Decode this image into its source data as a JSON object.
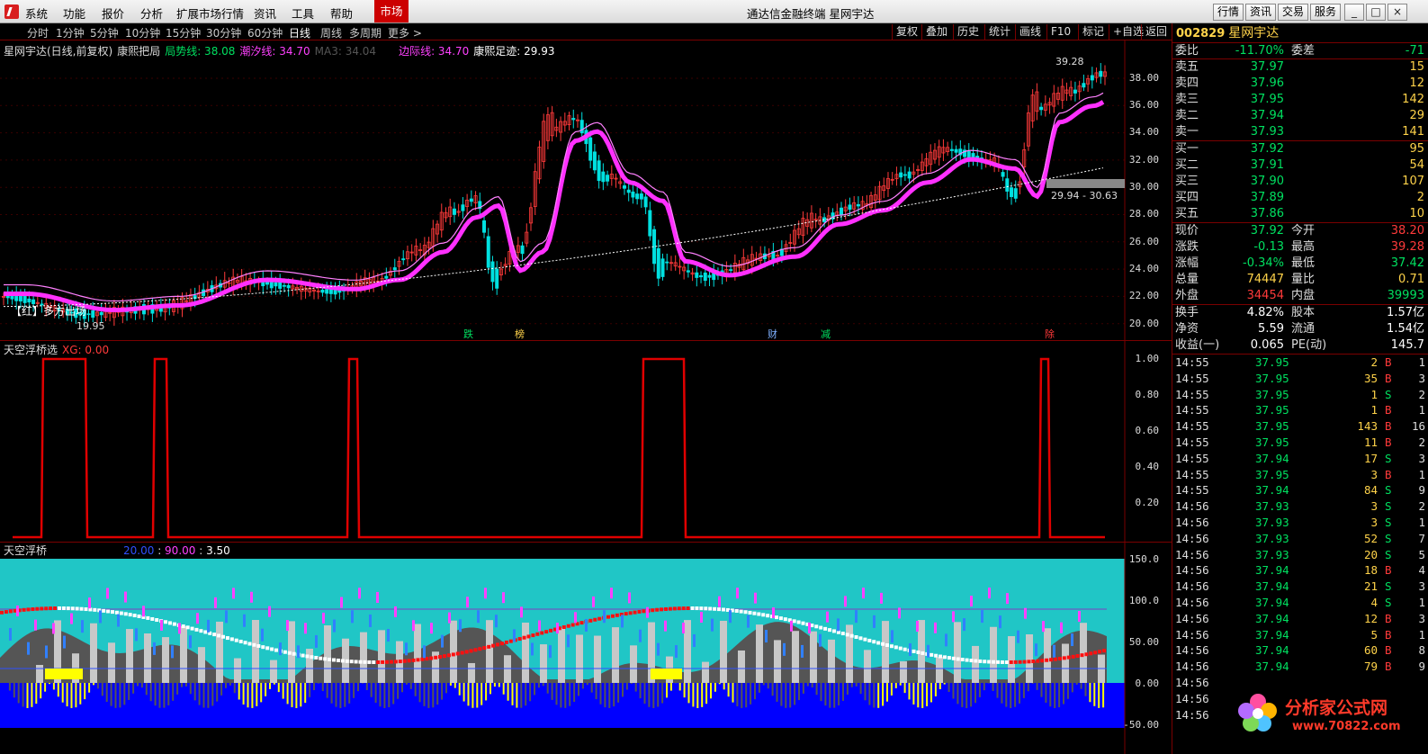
{
  "menu": [
    "系统",
    "功能",
    "报价",
    "分析",
    "扩展市场行情",
    "资讯",
    "工具",
    "帮助"
  ],
  "market_tab": "市场",
  "window_title": "通达信金融终端  星网宇达",
  "top_buttons": [
    "行情",
    "资讯",
    "交易",
    "服务"
  ],
  "window_controls": [
    "_",
    "□",
    "×"
  ],
  "periods": [
    "分时",
    "1分钟",
    "5分钟",
    "10分钟",
    "15分钟",
    "30分钟",
    "60分钟",
    "日线",
    "周线",
    "多周期",
    "更多 >"
  ],
  "active_period": "日线",
  "right_tools": [
    "复权",
    "叠加",
    "历史",
    "统计",
    "画线",
    "F10",
    "标记",
    "+自选",
    "返回"
  ],
  "main_chart": {
    "title": "星网宇达(日线,前复权)",
    "indicator": "康熙把局",
    "trend_label": "局势线: 38.08",
    "trend_color": "#00e060",
    "tide_label": "潮汐线: 34.70",
    "tide_color": "#ff40ff",
    "ma_label": "MA3: 34.04",
    "ma_color": "#555555",
    "edge_label": "边际线: 34.70",
    "edge_color": "#ff40ff",
    "trace_label": "康熙足迹: 29.93",
    "trace_color": "#ffffff",
    "high_marker": "39.28",
    "low_marker": "19.95",
    "range_marker": "29.94 - 30.63",
    "tag_label": "【红】多方出场",
    "event_tags": [
      "跌",
      "榜",
      "财",
      "减",
      "除"
    ],
    "y_ticks": [
      "38.00",
      "36.00",
      "34.00",
      "32.00",
      "30.00",
      "28.00",
      "26.00",
      "24.00",
      "22.00",
      "20.00"
    ]
  },
  "sub1": {
    "title": "天空浮桥选",
    "xg_label": "XG: 0.00",
    "y_ticks": [
      "1.00",
      "0.80",
      "0.60",
      "0.40",
      "0.20"
    ]
  },
  "sub2": {
    "title": "天空浮桥",
    "v1": "20.00",
    "v2": "90.00",
    "v3": "3.50",
    "y_ticks": [
      "150.0",
      "100.0",
      "50.00",
      "0.00",
      "-50.00"
    ]
  },
  "quote": {
    "code": "002829",
    "name": "星网宇达",
    "weibi_label": "委比",
    "weibi": "-11.70%",
    "weicha_label": "委差",
    "weicha": "-71",
    "asks": [
      {
        "label": "卖五",
        "price": "37.97",
        "vol": "15"
      },
      {
        "label": "卖四",
        "price": "37.96",
        "vol": "12"
      },
      {
        "label": "卖三",
        "price": "37.95",
        "vol": "142"
      },
      {
        "label": "卖二",
        "price": "37.94",
        "vol": "29"
      },
      {
        "label": "卖一",
        "price": "37.93",
        "vol": "141"
      }
    ],
    "bids": [
      {
        "label": "买一",
        "price": "37.92",
        "vol": "95"
      },
      {
        "label": "买二",
        "price": "37.91",
        "vol": "54"
      },
      {
        "label": "买三",
        "price": "37.90",
        "vol": "107"
      },
      {
        "label": "买四",
        "price": "37.89",
        "vol": "2"
      },
      {
        "label": "买五",
        "price": "37.86",
        "vol": "10"
      }
    ],
    "stats": [
      {
        "k1": "现价",
        "v1": "37.92",
        "c1": "green",
        "k2": "今开",
        "v2": "38.20",
        "c2": "red"
      },
      {
        "k1": "涨跌",
        "v1": "-0.13",
        "c1": "green",
        "k2": "最高",
        "v2": "39.28",
        "c2": "red"
      },
      {
        "k1": "涨幅",
        "v1": "-0.34%",
        "c1": "green",
        "k2": "最低",
        "v2": "37.42",
        "c2": "green"
      },
      {
        "k1": "总量",
        "v1": "74447",
        "c1": "yellow",
        "k2": "量比",
        "v2": "0.71",
        "c2": "yellow"
      },
      {
        "k1": "外盘",
        "v1": "34454",
        "c1": "red",
        "k2": "内盘",
        "v2": "39993",
        "c2": "green"
      }
    ],
    "fund": [
      {
        "k1": "换手",
        "v1": "4.82%",
        "k2": "股本",
        "v2": "1.57亿"
      },
      {
        "k1": "净资",
        "v1": "5.59",
        "k2": "流通",
        "v2": "1.54亿"
      },
      {
        "k1": "收益(一)",
        "v1": "0.065",
        "k2": "PE(动)",
        "v2": "145.7"
      }
    ],
    "ticks": [
      {
        "t": "14:55",
        "p": "37.95",
        "q": "2",
        "s": "B",
        "n": "1"
      },
      {
        "t": "14:55",
        "p": "37.95",
        "q": "35",
        "s": "B",
        "n": "3"
      },
      {
        "t": "14:55",
        "p": "37.95",
        "q": "1",
        "s": "S",
        "n": "2"
      },
      {
        "t": "14:55",
        "p": "37.95",
        "q": "1",
        "s": "B",
        "n": "1"
      },
      {
        "t": "14:55",
        "p": "37.95",
        "q": "143",
        "s": "B",
        "n": "16"
      },
      {
        "t": "14:55",
        "p": "37.95",
        "q": "11",
        "s": "B",
        "n": "2"
      },
      {
        "t": "14:55",
        "p": "37.94",
        "q": "17",
        "s": "S",
        "n": "3"
      },
      {
        "t": "14:55",
        "p": "37.95",
        "q": "3",
        "s": "B",
        "n": "1"
      },
      {
        "t": "14:55",
        "p": "37.94",
        "q": "84",
        "s": "S",
        "n": "9"
      },
      {
        "t": "14:56",
        "p": "37.93",
        "q": "3",
        "s": "S",
        "n": "2"
      },
      {
        "t": "14:56",
        "p": "37.93",
        "q": "3",
        "s": "S",
        "n": "1"
      },
      {
        "t": "14:56",
        "p": "37.93",
        "q": "52",
        "s": "S",
        "n": "7"
      },
      {
        "t": "14:56",
        "p": "37.93",
        "q": "20",
        "s": "S",
        "n": "5"
      },
      {
        "t": "14:56",
        "p": "37.94",
        "q": "18",
        "s": "B",
        "n": "4"
      },
      {
        "t": "14:56",
        "p": "37.94",
        "q": "21",
        "s": "S",
        "n": "3"
      },
      {
        "t": "14:56",
        "p": "37.94",
        "q": "4",
        "s": "S",
        "n": "1"
      },
      {
        "t": "14:56",
        "p": "37.94",
        "q": "12",
        "s": "B",
        "n": "3"
      },
      {
        "t": "14:56",
        "p": "37.94",
        "q": "5",
        "s": "B",
        "n": "1"
      },
      {
        "t": "14:56",
        "p": "37.94",
        "q": "60",
        "s": "B",
        "n": "8"
      },
      {
        "t": "14:56",
        "p": "37.94",
        "q": "79",
        "s": "B",
        "n": "9"
      },
      {
        "t": "14:56",
        "p": "",
        "q": "",
        "s": "",
        "n": ""
      },
      {
        "t": "14:56",
        "p": "",
        "q": "",
        "s": "",
        "n": ""
      },
      {
        "t": "14:56",
        "p": "",
        "q": "",
        "s": "",
        "n": ""
      }
    ]
  },
  "watermark": {
    "text": "分析家公式网",
    "url": "www.70822.com"
  },
  "colors": {
    "up": "#ff3a3a",
    "down": "#00e060",
    "accent": "#ffd34a",
    "frame": "#7a0000"
  }
}
